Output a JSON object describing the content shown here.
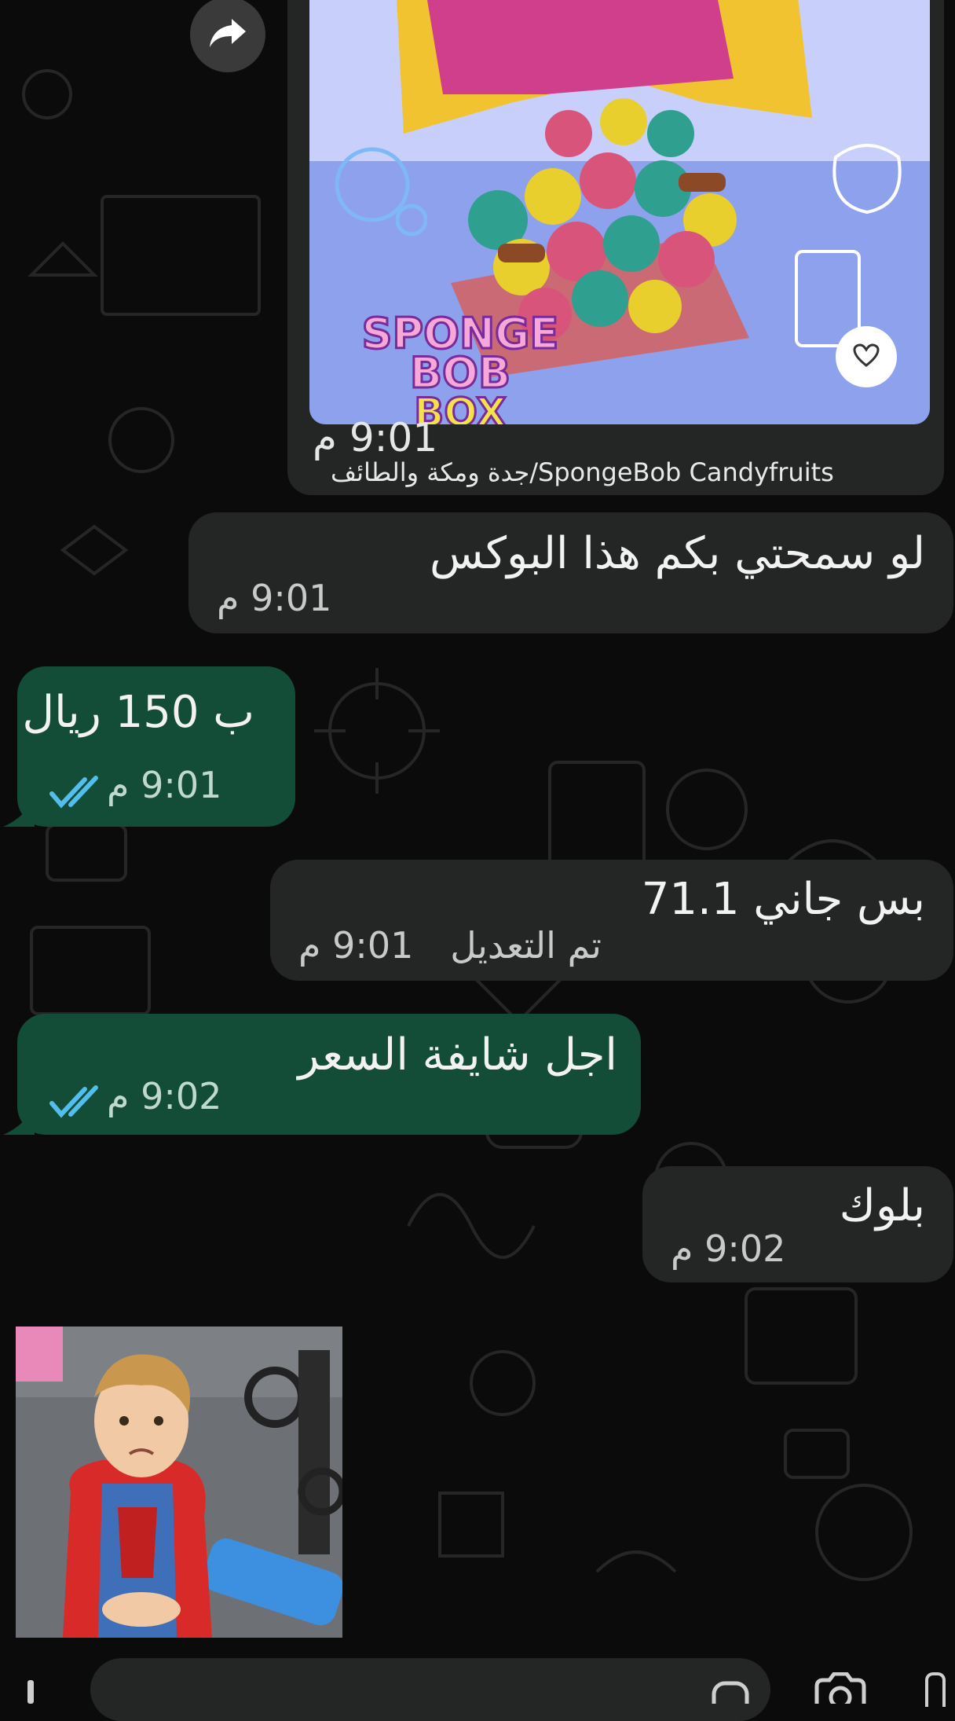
{
  "colors": {
    "background": "#0b0b0b",
    "incoming_bubble": "#242626",
    "outgoing_bubble": "#134d37",
    "read_ticks": "#53bdeb"
  },
  "shared_card": {
    "brand_text_line1": "SPONGE BOB",
    "brand_text_line2": "BOX",
    "time": "9:01 م",
    "link_text": "جدة ومكة والطائف/SpongeBob Candyfruits"
  },
  "messages": [
    {
      "direction": "in",
      "text": "لو سمحتي بكم هذا البوكس",
      "time": "9:01 م"
    },
    {
      "direction": "out",
      "text": "ب 150 ريال",
      "time": "9:01 م",
      "status": "read"
    },
    {
      "direction": "in",
      "text": "بس جاني 71.1",
      "time": "9:01 م",
      "edited_label": "تم التعديل"
    },
    {
      "direction": "out",
      "text": "اجل شايفة السعر",
      "time": "9:02 م",
      "status": "read"
    },
    {
      "direction": "in",
      "text": "بلوك",
      "time": "9:02 م"
    }
  ],
  "icons": {
    "forward": "forward-icon",
    "heart": "heart-icon",
    "ticks": "double-check-icon",
    "camera": "camera-icon",
    "attach": "attach-icon"
  }
}
